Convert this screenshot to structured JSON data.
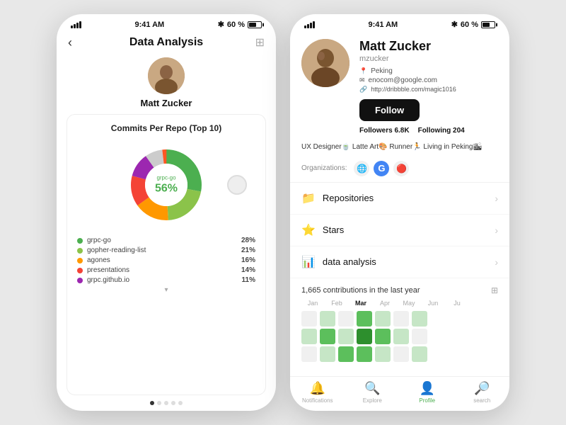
{
  "leftPhone": {
    "statusBar": {
      "time": "9:41 AM",
      "battery": "60 %"
    },
    "header": {
      "backLabel": "‹",
      "title": "Data Analysis",
      "gridIcon": "⊞"
    },
    "profile": {
      "name": "Matt Zucker",
      "avatarEmoji": "👤"
    },
    "chart": {
      "title": "Commits Per Repo (Top 10)",
      "topLabel": "grpc-go",
      "topPercent": "56%",
      "legend": [
        {
          "name": "grpc-go",
          "pct": "28%",
          "color": "#4caf50"
        },
        {
          "name": "gopher-reading-list",
          "pct": "21%",
          "color": "#8bc34a"
        },
        {
          "name": "agones",
          "pct": "16%",
          "color": "#ff9800"
        },
        {
          "name": "presentations",
          "pct": "14%",
          "color": "#f44336"
        },
        {
          "name": "grpc.github.io",
          "pct": "11%",
          "color": "#9c27b0"
        },
        {
          "name": "",
          "pct": "8%",
          "color": "#ccc"
        }
      ]
    },
    "dots": [
      true,
      false,
      false,
      false,
      false
    ],
    "moreArrow": "▾"
  },
  "rightPhone": {
    "statusBar": {
      "time": "9:41 AM",
      "battery": "60 %"
    },
    "profile": {
      "name": "Matt Zucker",
      "username": "mzucker",
      "location": "Peking",
      "email": "enocom@google.com",
      "website": "http://dribbble.com/magic1016",
      "followBtn": "Follow",
      "followers": "6.8K",
      "following": "204",
      "followersLabel": "Followers",
      "followingLabel": "Following",
      "bio": "UX Designer🍵 Latte Art🎨 Runner🏃\nLiving in Peking🏙",
      "orgsLabel": "Organizations:",
      "orgs": [
        "🌐",
        "G",
        "🔴"
      ]
    },
    "menu": [
      {
        "icon": "📁",
        "label": "Repositories"
      },
      {
        "icon": "⭐",
        "label": "Stars"
      },
      {
        "icon": "📊",
        "label": "data analysis"
      }
    ],
    "contributions": {
      "title": "1,665 contributions in the last year",
      "months": [
        "Jan",
        "Feb",
        "Mar",
        "Apr",
        "May",
        "Jun",
        "Ju"
      ],
      "activeMonth": "Mar"
    },
    "bottomNav": [
      {
        "icon": "🔔",
        "label": "Notifications",
        "active": false
      },
      {
        "icon": "🔍",
        "label": "Explore",
        "active": false
      },
      {
        "icon": "👤",
        "label": "Profile",
        "active": true
      },
      {
        "icon": "🔎",
        "label": "search",
        "active": false
      }
    ]
  }
}
